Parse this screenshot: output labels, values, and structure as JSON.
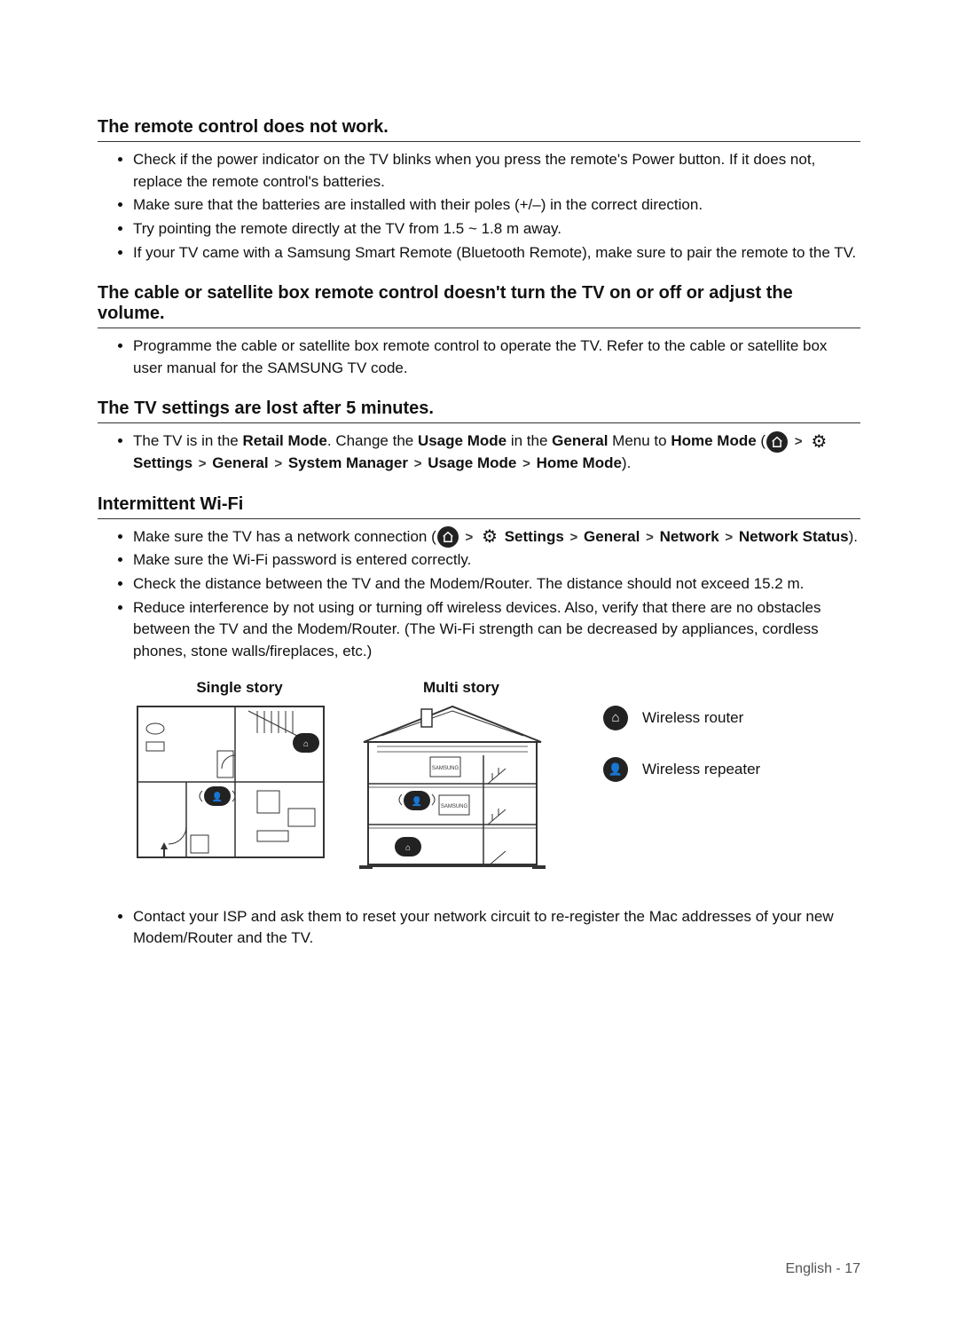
{
  "sections": [
    {
      "title": "The remote control does not work.",
      "bullets": [
        {
          "type": "plain",
          "text": "Check if the power indicator on the TV blinks when you press the remote's Power button. If it does not, replace the remote control's batteries."
        },
        {
          "type": "plain",
          "text": "Make sure that the batteries are installed with their poles (+/–) in the correct direction."
        },
        {
          "type": "plain",
          "text": "Try pointing the remote directly at the TV from 1.5 ~ 1.8 m away."
        },
        {
          "type": "plain",
          "text": "If your TV came with a Samsung Smart Remote (Bluetooth Remote), make sure to pair the remote to the TV."
        }
      ]
    },
    {
      "title": "The cable or satellite box remote control doesn't turn the TV on or off or adjust the volume.",
      "bullets": [
        {
          "type": "plain",
          "text": "Programme the cable or satellite box remote control to operate the TV. Refer to the cable or satellite box user manual for the SAMSUNG TV code."
        }
      ]
    },
    {
      "title": "The TV settings are lost after 5 minutes.",
      "bullets": [
        {
          "type": "rich",
          "parts": [
            {
              "t": "text",
              "v": "The TV is in the "
            },
            {
              "t": "bold",
              "v": "Retail Mode"
            },
            {
              "t": "text",
              "v": ". Change the "
            },
            {
              "t": "bold",
              "v": "Usage Mode"
            },
            {
              "t": "text",
              "v": " in the "
            },
            {
              "t": "bold",
              "v": "General"
            },
            {
              "t": "text",
              "v": " Menu to "
            },
            {
              "t": "bold",
              "v": "Home Mode"
            },
            {
              "t": "text",
              "v": " ("
            },
            {
              "t": "home-icon"
            },
            {
              "t": "chev"
            },
            {
              "t": "gear-icon"
            },
            {
              "t": "bold",
              "v": " Settings"
            },
            {
              "t": "chev"
            },
            {
              "t": "bold",
              "v": "General"
            },
            {
              "t": "chev"
            },
            {
              "t": "bold",
              "v": "System Manager"
            },
            {
              "t": "chev"
            },
            {
              "t": "bold",
              "v": "Usage Mode"
            },
            {
              "t": "chev"
            },
            {
              "t": "bold",
              "v": "Home Mode"
            },
            {
              "t": "text",
              "v": ")."
            }
          ]
        }
      ]
    },
    {
      "title": "Intermittent Wi-Fi",
      "bullets": [
        {
          "type": "rich",
          "parts": [
            {
              "t": "text",
              "v": "Make sure the TV has a network connection ("
            },
            {
              "t": "home-icon"
            },
            {
              "t": "chev"
            },
            {
              "t": "gear-icon"
            },
            {
              "t": "bold",
              "v": " Settings"
            },
            {
              "t": "chev"
            },
            {
              "t": "bold",
              "v": "General"
            },
            {
              "t": "chev"
            },
            {
              "t": "bold",
              "v": "Network"
            },
            {
              "t": "chev"
            },
            {
              "t": "bold",
              "v": "Network Status"
            },
            {
              "t": "text",
              "v": ")."
            }
          ]
        },
        {
          "type": "plain",
          "text": "Make sure the Wi-Fi password is entered correctly."
        },
        {
          "type": "plain",
          "text": "Check the distance between the TV and the Modem/Router. The distance should not exceed 15.2 m."
        },
        {
          "type": "plain",
          "text": "Reduce interference by not using or turning off wireless devices. Also, verify that there are no obstacles between the TV and the Modem/Router. (The Wi-Fi strength can be decreased by appliances, cordless phones, stone walls/fireplaces, etc.)"
        }
      ]
    }
  ],
  "diagram": {
    "col1_title": "Single story",
    "col2_title": "Multi story",
    "legend_router": "Wireless router",
    "legend_repeater": "Wireless repeater"
  },
  "after_bullets": [
    {
      "type": "plain",
      "text": "Contact your ISP and ask them to reset your network circuit to re-register the Mac addresses of your new Modem/Router and the TV."
    }
  ],
  "footer": {
    "lang": "English",
    "sep": " - ",
    "page": "17"
  },
  "chev_glyph": ">"
}
